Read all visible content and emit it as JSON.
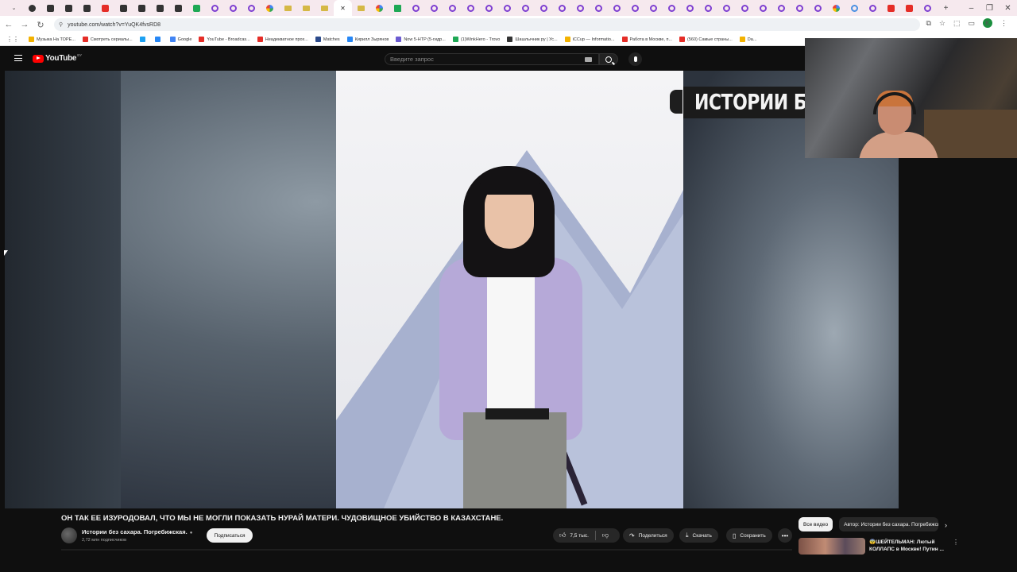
{
  "browser": {
    "url": "youtube.com/watch?v=YuQK4fvsRD8",
    "bookmarks": [
      {
        "label": "Музыка На ТОРЕ...",
        "color": "#f3b200"
      },
      {
        "label": "Смотреть сериалы...",
        "color": "#e52d27"
      },
      {
        "label": "",
        "color": "#1da1f2"
      },
      {
        "label": "",
        "color": "#2787f5"
      },
      {
        "label": "Google",
        "color": "#4285f4"
      },
      {
        "label": "YouTube - Broadcas...",
        "color": "#e52d27"
      },
      {
        "label": "Неадекватное прох...",
        "color": "#e52d27"
      },
      {
        "label": "Matches",
        "color": "#2b4a8b"
      },
      {
        "label": "Кирилл Зырянов",
        "color": "#2787f5"
      },
      {
        "label": "Now 5-HTP (5-гидр...",
        "color": "#6b5bd1"
      },
      {
        "label": "(1)WinkHero - Trovo",
        "color": "#1fa855"
      },
      {
        "label": "Шашлычник ру | Ус...",
        "color": "#333333"
      },
      {
        "label": "iCCup — Informatio...",
        "color": "#f3b200"
      },
      {
        "label": "Работа в Москве, п...",
        "color": "#e52d27"
      },
      {
        "label": "(560) Самые страны...",
        "color": "#e52d27"
      },
      {
        "label": "Da...",
        "color": "#f3b200"
      }
    ]
  },
  "youtube": {
    "logo_text": "YouTube",
    "logo_country": "BY",
    "search_placeholder": "Введите запрос",
    "video_banner": "ИСТОРИИ БЕЗ",
    "video_title": "ОН ТАК ЕЕ ИЗУРОДОВАЛ, ЧТО МЫ НЕ МОГЛИ ПОКАЗАТЬ НУРАЙ МАТЕРИ. ЧУДОВИЩНОЕ УБИЙСТВО В КАЗАХСТАНЕ.",
    "channel_name": "Истории без сахара. Погребижская.",
    "subscribers": "2,72 млн подписчиков",
    "subscribe_label": "Подписаться",
    "likes": "7,5 тыс.",
    "share_label": "Поделиться",
    "download_label": "Скачать",
    "save_label": "Сохранить",
    "chip_all": "Все видео",
    "chip_author": "Автор: Истории без сахара. Погребижская.",
    "rec_title": "😨ШЕЙТЕЛЬМАН: Лютый КОЛЛАПС в Москве! Путин ..."
  }
}
